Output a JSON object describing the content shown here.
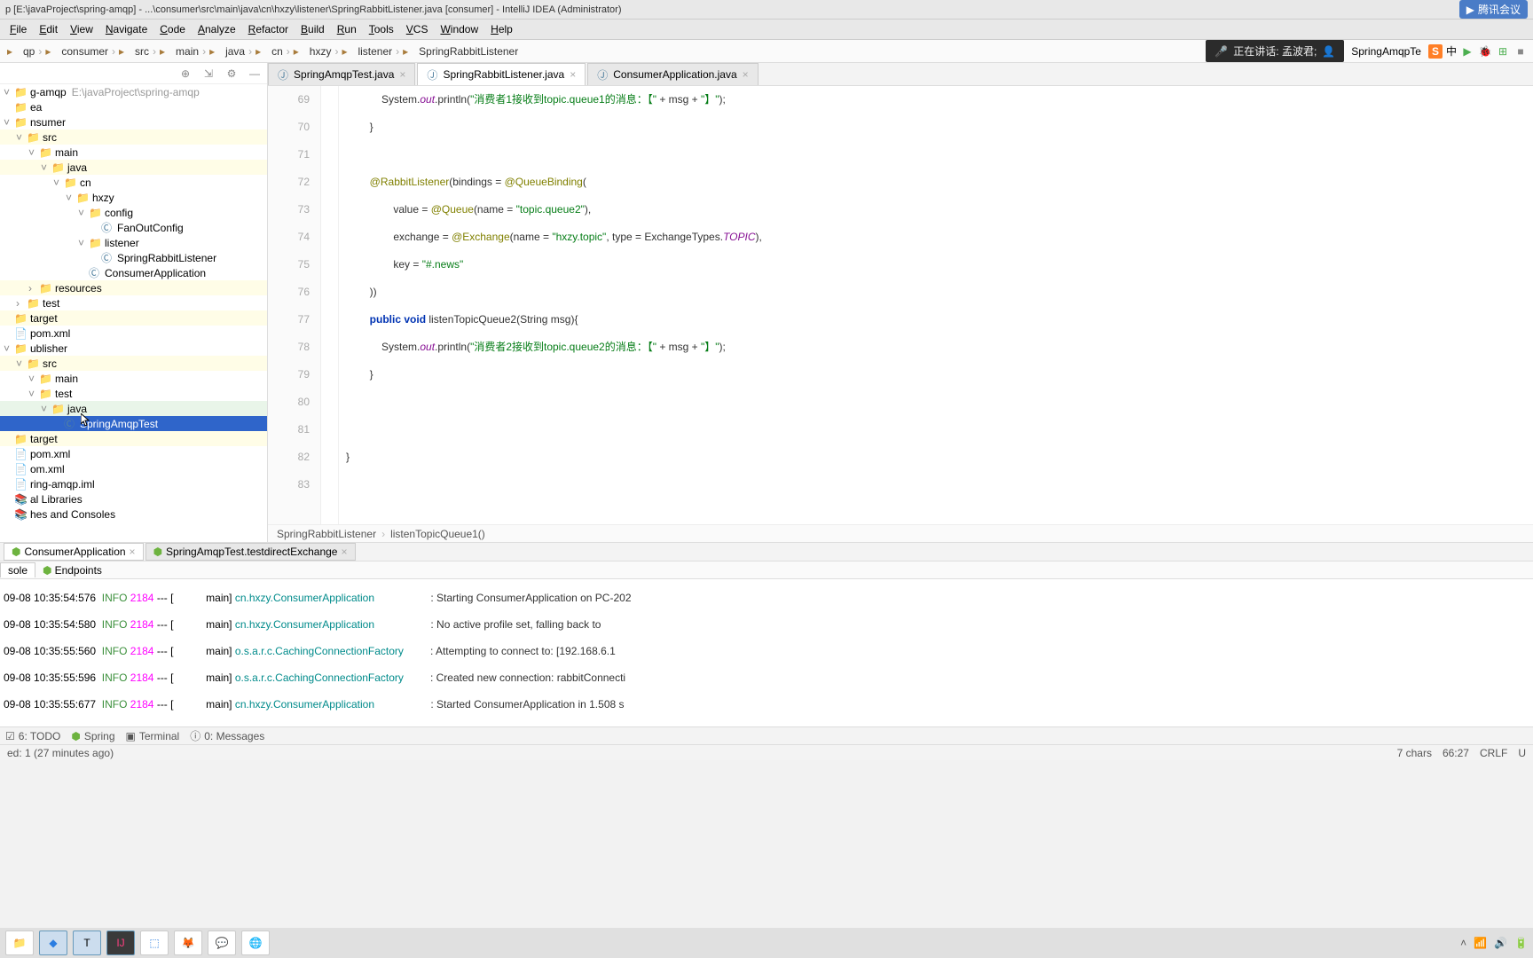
{
  "title": "p [E:\\javaProject\\spring-amqp] - ...\\consumer\\src\\main\\java\\cn\\hxzy\\listener\\SpringRabbitListener.java [consumer] - IntelliJ IDEA (Administrator)",
  "cloud_app": "腾讯会议",
  "menu": [
    "File",
    "Edit",
    "View",
    "Navigate",
    "Code",
    "Analyze",
    "Refactor",
    "Build",
    "Run",
    "Tools",
    "VCS",
    "Window",
    "Help"
  ],
  "breadcrumb": [
    "qp",
    "consumer",
    "src",
    "main",
    "java",
    "cn",
    "hxzy",
    "listener",
    "SpringRabbitListener"
  ],
  "meeting_text": "正在讲话: 孟波君;",
  "nav_label": "SpringAmqpTe",
  "tree": [
    {
      "d": 0,
      "a": "v",
      "i": "folder",
      "l": "g-amqp",
      "hint": "E:\\javaProject\\spring-amqp"
    },
    {
      "d": 0,
      "a": " ",
      "i": "folder",
      "l": "ea"
    },
    {
      "d": 0,
      "a": "v",
      "i": "folder",
      "l": "nsumer"
    },
    {
      "d": 1,
      "a": "v",
      "i": "folder",
      "l": "src",
      "cls": "hl"
    },
    {
      "d": 2,
      "a": "v",
      "i": "folder",
      "l": "main"
    },
    {
      "d": 3,
      "a": "v",
      "i": "folder",
      "l": "java",
      "cls": "hl"
    },
    {
      "d": 4,
      "a": "v",
      "i": "folder",
      "l": "cn"
    },
    {
      "d": 5,
      "a": "v",
      "i": "folder",
      "l": "hxzy"
    },
    {
      "d": 6,
      "a": "v",
      "i": "folder",
      "l": "config"
    },
    {
      "d": 7,
      "a": " ",
      "i": "class",
      "l": "FanOutConfig"
    },
    {
      "d": 6,
      "a": "v",
      "i": "folder",
      "l": "listener"
    },
    {
      "d": 7,
      "a": " ",
      "i": "class",
      "l": "SpringRabbitListener"
    },
    {
      "d": 6,
      "a": " ",
      "i": "class",
      "l": "ConsumerApplication"
    },
    {
      "d": 2,
      "a": ">",
      "i": "folder",
      "l": "resources",
      "cls": "hl"
    },
    {
      "d": 1,
      "a": ">",
      "i": "folder",
      "l": "test"
    },
    {
      "d": 0,
      "a": " ",
      "i": "folder",
      "l": "target",
      "cls": "hl"
    },
    {
      "d": 0,
      "a": " ",
      "i": "file",
      "l": "pom.xml"
    },
    {
      "d": 0,
      "a": "v",
      "i": "folder",
      "l": "ublisher"
    },
    {
      "d": 1,
      "a": "v",
      "i": "folder",
      "l": "src",
      "cls": "hl"
    },
    {
      "d": 2,
      "a": "v",
      "i": "folder",
      "l": "main"
    },
    {
      "d": 2,
      "a": "v",
      "i": "folder",
      "l": "test"
    },
    {
      "d": 3,
      "a": "v",
      "i": "folder",
      "l": "java",
      "cls": "hl2"
    },
    {
      "d": 4,
      "a": " ",
      "i": "class",
      "l": "SpringAmqpTest",
      "cls": "selected"
    },
    {
      "d": 0,
      "a": " ",
      "i": "folder",
      "l": "target",
      "cls": "hl"
    },
    {
      "d": 0,
      "a": " ",
      "i": "file",
      "l": "pom.xml"
    },
    {
      "d": 0,
      "a": " ",
      "i": "file",
      "l": "om.xml"
    },
    {
      "d": 0,
      "a": " ",
      "i": "file",
      "l": "ring-amqp.iml"
    },
    {
      "d": 0,
      "a": " ",
      "i": "lib",
      "l": "al Libraries"
    },
    {
      "d": 0,
      "a": " ",
      "i": "lib",
      "l": "hes and Consoles"
    }
  ],
  "tabs": [
    {
      "label": "SpringAmqpTest.java",
      "active": false
    },
    {
      "label": "SpringRabbitListener.java",
      "active": true
    },
    {
      "label": "ConsumerApplication.java",
      "active": false
    }
  ],
  "gutter": [
    "69",
    "70",
    "71",
    "72",
    "73",
    "74",
    "75",
    "76",
    "77",
    "78",
    "79",
    "80",
    "81",
    "82",
    "83"
  ],
  "code": {
    "l69": {
      "pre": "            System.",
      "out": "out",
      "post": ".println(",
      "s": "\"消费者1接收到topic.queue1的消息：【\"",
      "mid": " + msg + ",
      "s2": "\"】\"",
      "end": ");"
    },
    "l70": "        }",
    "l71": "",
    "l72": {
      "pre": "        ",
      "ann": "@RabbitListener",
      "post": "(bindings = ",
      "ann2": "@QueueBinding",
      "end": "("
    },
    "l73": {
      "pre": "                value = ",
      "ann": "@Queue",
      "post": "(name = ",
      "s": "\"topic.queue2\"",
      "end": "),"
    },
    "l74": {
      "pre": "                exchange = ",
      "ann": "@Exchange",
      "post": "(name = ",
      "s": "\"hxzy.topic\"",
      "mid": ", type = ExchangeTypes.",
      "f": "TOPIC",
      "end": "),"
    },
    "l75": {
      "pre": "                key = ",
      "s": "\"#.news\""
    },
    "l76": "        ))",
    "l77": {
      "pre": "        ",
      "k1": "public",
      "sp": " ",
      "k2": "void",
      "post": " listenTopicQueue2(String msg){"
    },
    "l78": {
      "pre": "            System.",
      "out": "out",
      "post": ".println(",
      "s": "\"消费者2接收到topic.queue2的消息：【\"",
      "mid": " + msg + ",
      "s2": "\"】\"",
      "end": ");"
    },
    "l79": "        }",
    "l80": "",
    "l81": "",
    "l82": "}",
    "l83": ""
  },
  "crumb_bottom": [
    "SpringRabbitListener",
    "listenTopicQueue1()"
  ],
  "run_tabs": [
    "ConsumerApplication",
    "SpringAmqpTest.testdirectExchange"
  ],
  "sub_tabs": [
    "sole",
    "Endpoints"
  ],
  "console": [
    {
      "ts": "09-08 10:35:54:576",
      "lv": "INFO",
      "pid": "2184",
      "dash": " --- [",
      "th": "main] ",
      "cls": "cn.hxzy.ConsumerApplication",
      "pad": "                   ",
      "msg": ": Starting ConsumerApplication on PC-202"
    },
    {
      "ts": "09-08 10:35:54:580",
      "lv": "INFO",
      "pid": "2184",
      "dash": " --- [",
      "th": "main] ",
      "cls": "cn.hxzy.ConsumerApplication",
      "pad": "                   ",
      "msg": ": No active profile set, falling back to"
    },
    {
      "ts": "09-08 10:35:55:560",
      "lv": "INFO",
      "pid": "2184",
      "dash": " --- [",
      "th": "main] ",
      "cls": "o.s.a.r.c.CachingConnectionFactory",
      "pad": "         ",
      "msg": ": Attempting to connect to: [192.168.6.1"
    },
    {
      "ts": "09-08 10:35:55:596",
      "lv": "INFO",
      "pid": "2184",
      "dash": " --- [",
      "th": "main] ",
      "cls": "o.s.a.r.c.CachingConnectionFactory",
      "pad": "         ",
      "msg": ": Created new connection: rabbitConnecti"
    },
    {
      "ts": "09-08 10:35:55:677",
      "lv": "INFO",
      "pid": "2184",
      "dash": " --- [",
      "th": "main] ",
      "cls": "cn.hxzy.ConsumerApplication",
      "pad": "                   ",
      "msg": ": Started ConsumerApplication in 1.508 s"
    }
  ],
  "tool_strip": [
    "6: TODO",
    "Spring",
    "Terminal",
    "0: Messages"
  ],
  "status_left": "ed: 1 (27 minutes ago)",
  "status_right": [
    "7 chars",
    "66:27",
    "CRLF",
    "U"
  ],
  "ime_label": "中"
}
